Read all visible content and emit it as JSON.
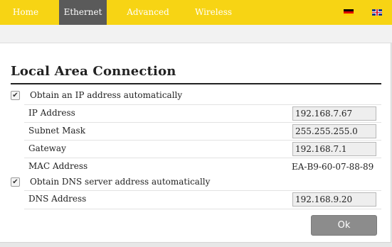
{
  "nav": {
    "items": [
      {
        "label": "Home",
        "active": false
      },
      {
        "label": "Ethernet",
        "active": true
      },
      {
        "label": "Advanced",
        "active": false
      },
      {
        "label": "Wireless",
        "active": false
      }
    ],
    "languages": [
      {
        "icon": "german-flag-icon"
      },
      {
        "icon": "uk-flag-icon"
      }
    ],
    "colors": {
      "bar": "#f7d414",
      "active_tab": "#5a5a5a",
      "text": "#ffffff"
    }
  },
  "panel": {
    "title": "Local Area Connection",
    "obtain_ip": {
      "label": "Obtain an IP address automatically",
      "checked": true,
      "check_glyph": "✔"
    },
    "ip_address": {
      "label": "IP Address",
      "value": "192.168.7.67"
    },
    "subnet_mask": {
      "label": "Subnet Mask",
      "value": "255.255.255.0"
    },
    "gateway": {
      "label": "Gateway",
      "value": "192.168.7.1"
    },
    "mac_address": {
      "label": "MAC Address",
      "value": "EA-B9-60-07-88-89"
    },
    "obtain_dns": {
      "label": "Obtain DNS server address automatically",
      "checked": true,
      "check_glyph": "✔"
    },
    "dns_address": {
      "label": "DNS Address",
      "value": "192.168.9.20"
    },
    "ok_label": "Ok"
  }
}
